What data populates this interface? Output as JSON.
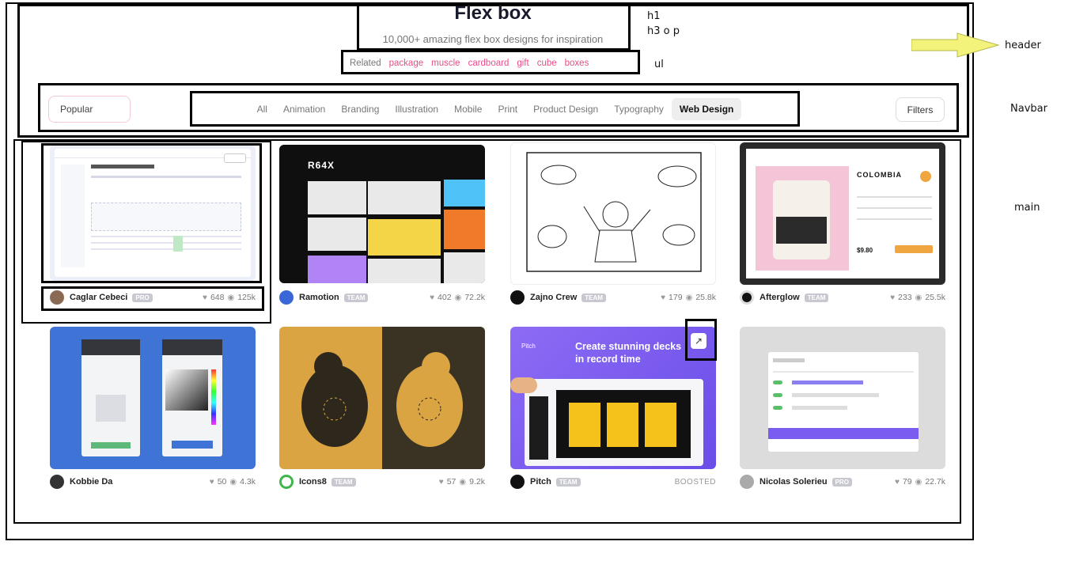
{
  "header": {
    "title": "Flex box",
    "subtitle": "10,000+ amazing flex box designs for inspiration",
    "related_label": "Related",
    "related": [
      "package",
      "muscle",
      "cardboard",
      "gift",
      "cube",
      "boxes"
    ]
  },
  "navbar": {
    "sort": "Popular",
    "categories": [
      "All",
      "Animation",
      "Branding",
      "Illustration",
      "Mobile",
      "Print",
      "Product Design",
      "Typography",
      "Web Design"
    ],
    "active": "Web Design",
    "filters": "Filters"
  },
  "annotations": {
    "h1": "h1",
    "h3": "h3 o p",
    "ul": "ul",
    "header": "header",
    "navbar": "Navbar",
    "main": "main"
  },
  "shots": [
    {
      "author": "Caglar Cebeci",
      "badge": "PRO",
      "likes": "648",
      "views": "125k"
    },
    {
      "author": "Ramotion",
      "badge": "TEAM",
      "likes": "402",
      "views": "72.2k"
    },
    {
      "author": "Zajno Crew",
      "badge": "TEAM",
      "likes": "179",
      "views": "25.8k"
    },
    {
      "author": "Afterglow",
      "badge": "TEAM",
      "likes": "233",
      "views": "25.5k"
    },
    {
      "author": "Kobbie Da",
      "badge": "",
      "likes": "50",
      "views": "4.3k"
    },
    {
      "author": "Icons8",
      "badge": "TEAM",
      "likes": "57",
      "views": "9.2k"
    },
    {
      "author": "Pitch",
      "badge": "TEAM",
      "boosted": "BOOSTED"
    },
    {
      "author": "Nicolas Solerieu",
      "badge": "PRO",
      "likes": "79",
      "views": "22.7k"
    }
  ],
  "shot_texts": {
    "r64x_logo": "R64X",
    "pitch_headline_1": "Create stunning decks",
    "pitch_headline_2": "in record time",
    "pitch_brand": "Pitch",
    "coffee_name": "COLOMBIA",
    "coffee_price": "$9.80"
  },
  "icons": {
    "like": "heart-icon",
    "view": "eye-icon",
    "external": "external-link-icon"
  },
  "colors": {
    "accent": "#ea4c89",
    "pitch_purple": "#7b5cf0",
    "kobbie_blue": "#3f73d6",
    "icons8_mustard": "#d9a441"
  }
}
